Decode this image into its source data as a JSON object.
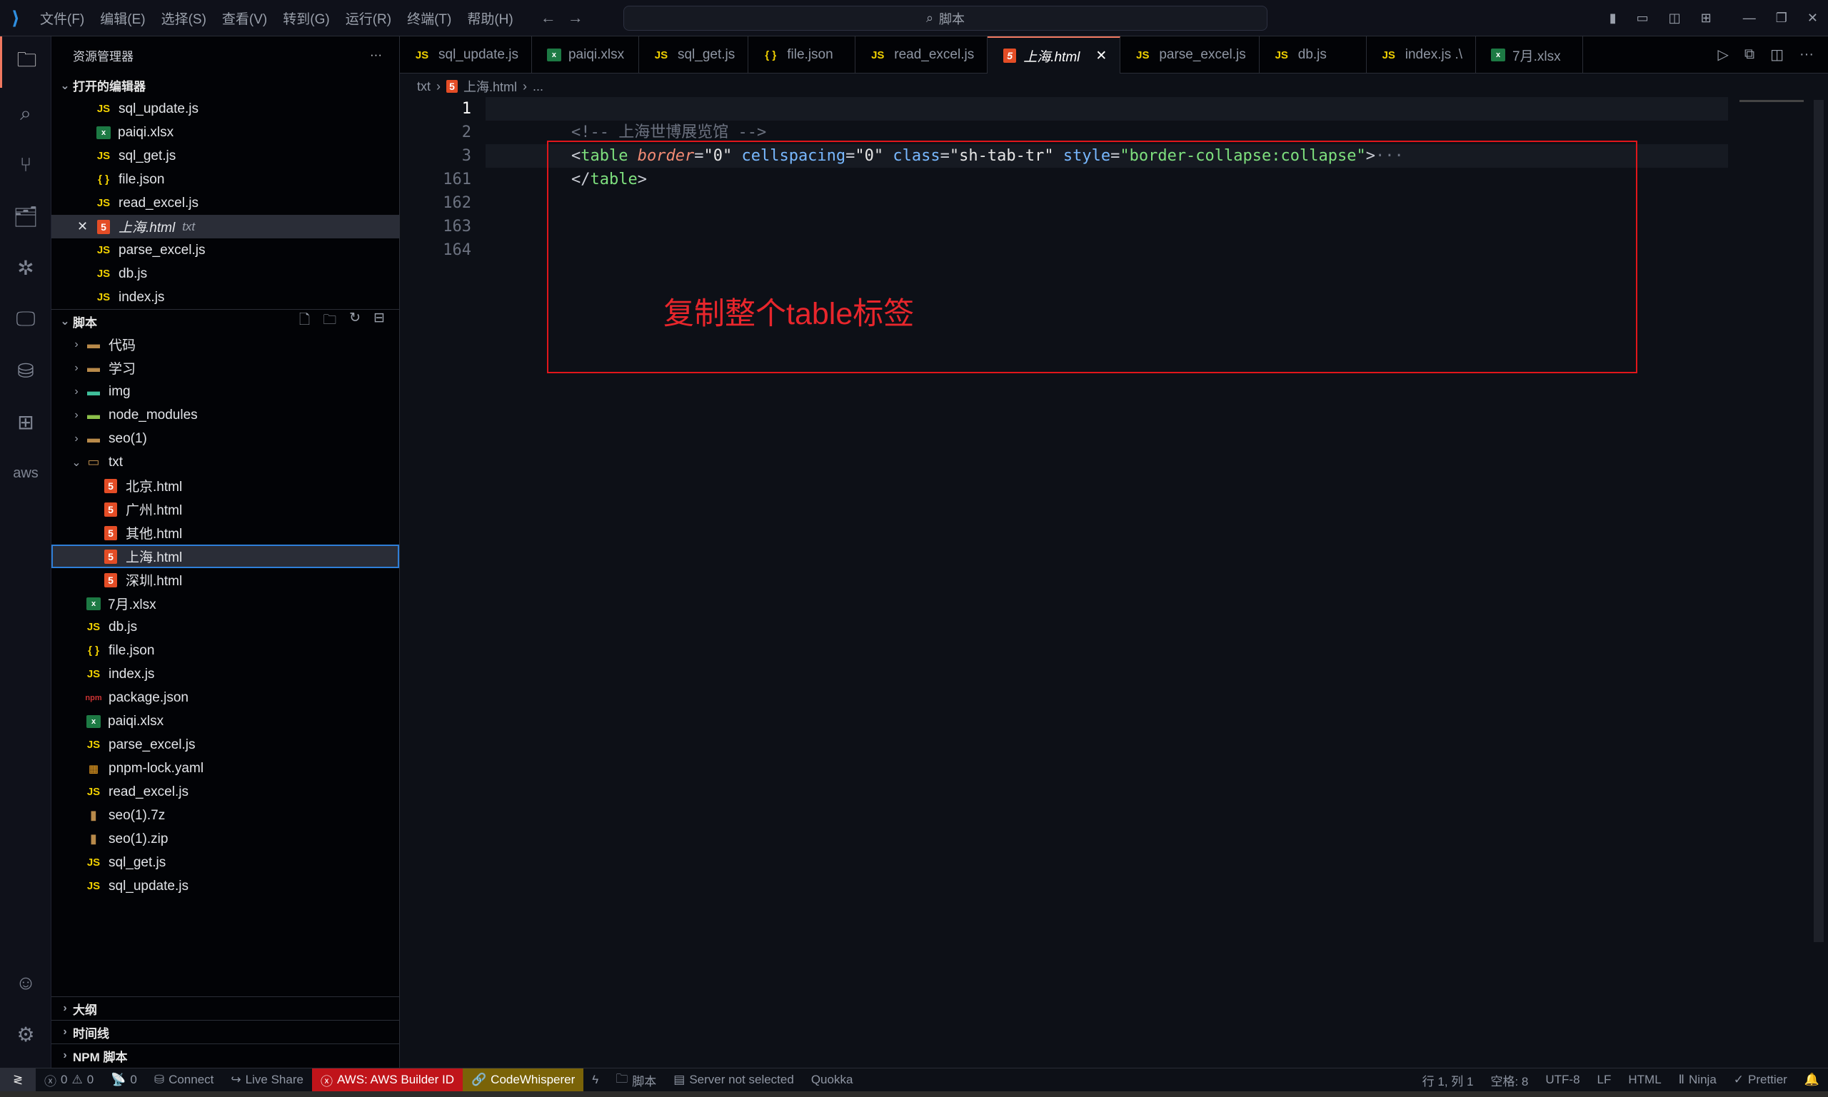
{
  "titlebar": {
    "menus": [
      "文件(F)",
      "编辑(E)",
      "选择(S)",
      "查看(V)",
      "转到(G)",
      "运行(R)",
      "终端(T)",
      "帮助(H)"
    ],
    "search": "脚本"
  },
  "sidebar": {
    "title": "资源管理器",
    "open_editors_label": "打开的编辑器",
    "open_editors": [
      {
        "name": "sql_update.js",
        "type": "js"
      },
      {
        "name": "paiqi.xlsx",
        "type": "xlsx"
      },
      {
        "name": "sql_get.js",
        "type": "js"
      },
      {
        "name": "file.json",
        "type": "json"
      },
      {
        "name": "read_excel.js",
        "type": "js"
      },
      {
        "name": "上海.html",
        "type": "html",
        "hint": "txt",
        "active": true
      },
      {
        "name": "parse_excel.js",
        "type": "js"
      },
      {
        "name": "db.js",
        "type": "js"
      },
      {
        "name": "index.js",
        "type": "js"
      }
    ],
    "folder_label": "脚本",
    "tree": [
      {
        "name": "代码",
        "type": "folder",
        "depth": 1
      },
      {
        "name": "学习",
        "type": "folder",
        "depth": 1
      },
      {
        "name": "img",
        "type": "imgfolder",
        "depth": 1
      },
      {
        "name": "node_modules",
        "type": "nodefolder",
        "depth": 1
      },
      {
        "name": "seo(1)",
        "type": "folder",
        "depth": 1
      },
      {
        "name": "txt",
        "type": "openfolder",
        "depth": 1
      },
      {
        "name": "北京.html",
        "type": "html",
        "depth": 2
      },
      {
        "name": "广州.html",
        "type": "html",
        "depth": 2
      },
      {
        "name": "其他.html",
        "type": "html",
        "depth": 2
      },
      {
        "name": "上海.html",
        "type": "html",
        "depth": 2,
        "focus": true
      },
      {
        "name": "深圳.html",
        "type": "html",
        "depth": 2
      },
      {
        "name": "7月.xlsx",
        "type": "xlsx",
        "depth": 1
      },
      {
        "name": "db.js",
        "type": "js",
        "depth": 1
      },
      {
        "name": "file.json",
        "type": "json",
        "depth": 1
      },
      {
        "name": "index.js",
        "type": "js",
        "depth": 1
      },
      {
        "name": "package.json",
        "type": "npm",
        "depth": 1
      },
      {
        "name": "paiqi.xlsx",
        "type": "xlsx",
        "depth": 1
      },
      {
        "name": "parse_excel.js",
        "type": "js",
        "depth": 1
      },
      {
        "name": "pnpm-lock.yaml",
        "type": "yaml",
        "depth": 1
      },
      {
        "name": "read_excel.js",
        "type": "js",
        "depth": 1
      },
      {
        "name": "seo(1).7z",
        "type": "zip",
        "depth": 1
      },
      {
        "name": "seo(1).zip",
        "type": "zip",
        "depth": 1
      },
      {
        "name": "sql_get.js",
        "type": "js",
        "depth": 1
      },
      {
        "name": "sql_update.js",
        "type": "js",
        "depth": 1
      }
    ],
    "panels": [
      "大纲",
      "时间线",
      "NPM 脚本"
    ]
  },
  "tabs": [
    {
      "name": "sql_update.js",
      "type": "js"
    },
    {
      "name": "paiqi.xlsx",
      "type": "xlsx"
    },
    {
      "name": "sql_get.js",
      "type": "js"
    },
    {
      "name": "file.json",
      "type": "json"
    },
    {
      "name": "read_excel.js",
      "type": "js"
    },
    {
      "name": "上海.html",
      "type": "html",
      "active": true
    },
    {
      "name": "parse_excel.js",
      "type": "js"
    },
    {
      "name": "db.js",
      "type": "js"
    },
    {
      "name": "index.js .\\",
      "type": "js"
    },
    {
      "name": "7月.xlsx",
      "type": "xlsx"
    }
  ],
  "breadcrumb": {
    "folder": "txt",
    "file": "上海.html",
    "more": "..."
  },
  "editor": {
    "line_numbers": [
      "1",
      "2",
      "3",
      "161",
      "162",
      "163",
      "164"
    ],
    "comment": "<!-- 上海世博展览馆 -->",
    "line3": {
      "open": "<",
      "tag": "table",
      "a1": "border",
      "v1": "\"0\"",
      "a2": "cellspacing",
      "v2": "\"0\"",
      "a3": "class",
      "v3": "\"sh-tab-tr\"",
      "a4": "style",
      "v4": "\"border-collapse:collapse\"",
      "close": ">",
      "ellipsis": "···"
    },
    "line161": {
      "open": "</",
      "tag": "table",
      "close": ">"
    },
    "annotation": "复制整个table标签"
  },
  "status": {
    "errors": "0",
    "warnings": "0",
    "ports": "0",
    "connect": "Connect",
    "liveshare": "Live Share",
    "aws": "AWS: AWS Builder ID",
    "codewhisperer": "CodeWhisperer",
    "folder": "脚本",
    "server": "Server not selected",
    "quokka": "Quokka",
    "position": "行 1, 列 1",
    "spaces": "空格: 8",
    "encoding": "UTF-8",
    "eol": "LF",
    "language": "HTML",
    "ninja": "Ninja",
    "prettier": "Prettier"
  }
}
